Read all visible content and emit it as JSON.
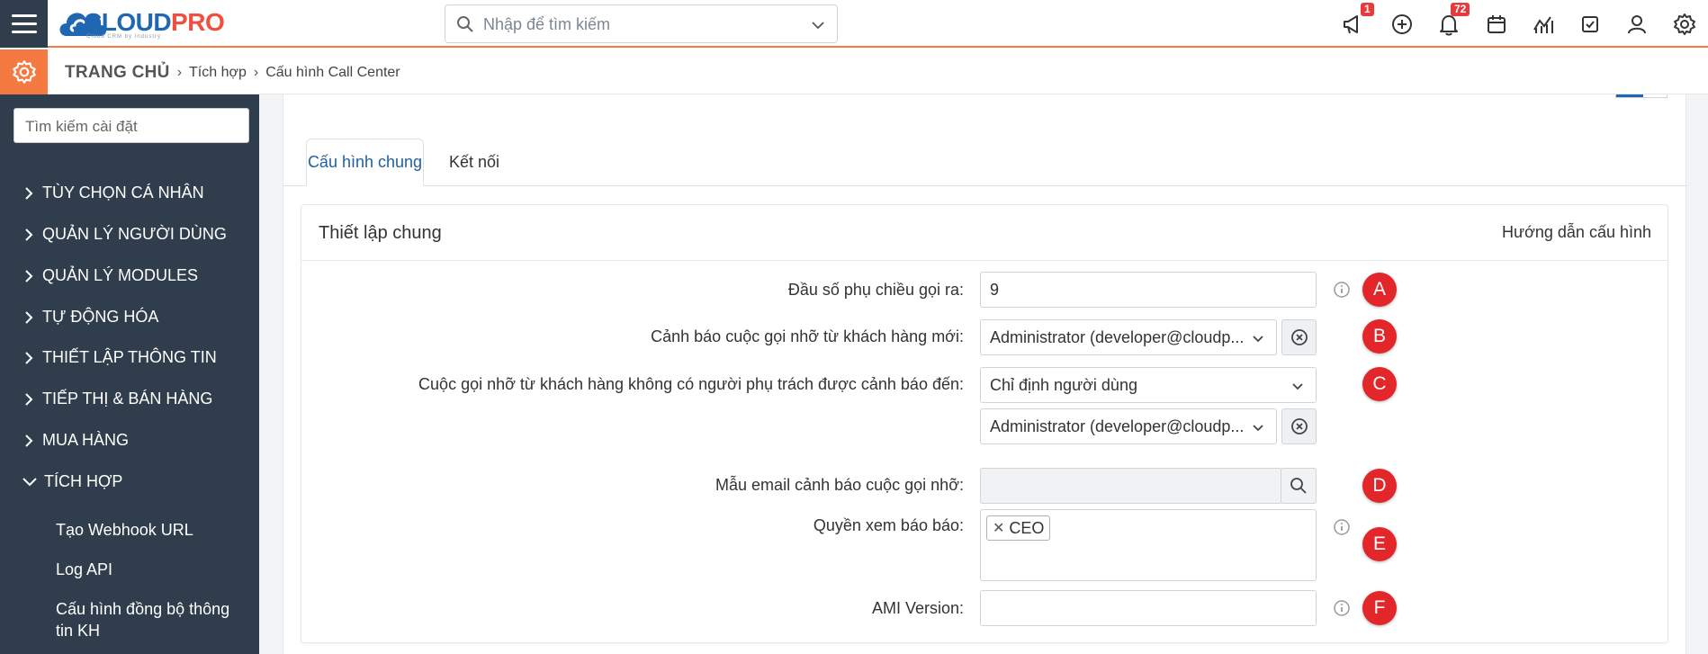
{
  "brand": {
    "name_main": "CLOUD",
    "name_accent": "PRO",
    "tagline": "Cloud CRM by Industry",
    "accent_color": "#f47a42",
    "primary_color": "#1f67b1"
  },
  "header": {
    "search_placeholder": "Nhập để tìm kiếm",
    "announcement_badge": "1",
    "notification_badge": "72"
  },
  "breadcrumb": {
    "home": "TRANG CHỦ",
    "level1": "Tích hợp",
    "level2": "Cấu hình Call Center"
  },
  "sidebar": {
    "search_placeholder": "Tìm kiếm cài đặt",
    "items": [
      {
        "label": "TÙY CHỌN CÁ NHÂN"
      },
      {
        "label": "QUẢN LÝ NGƯỜI DÙNG"
      },
      {
        "label": "QUẢN LÝ MODULES"
      },
      {
        "label": "TỰ ĐỘNG HÓA"
      },
      {
        "label": "THIẾT LẬP THÔNG TIN"
      },
      {
        "label": "TIẾP THỊ & BÁN HÀNG"
      },
      {
        "label": "MUA HÀNG"
      },
      {
        "label": "TÍCH HỢP"
      }
    ],
    "subitems": [
      {
        "label": "Tạo Webhook URL"
      },
      {
        "label": "Log API"
      },
      {
        "label": "Cấu hình đồng bộ thông tin KH"
      }
    ]
  },
  "tabs": [
    {
      "label": "Cấu hình chung"
    },
    {
      "label": "Kết nối"
    }
  ],
  "card": {
    "title": "Thiết lập chung",
    "help_link": "Hướng dẫn cấu hình"
  },
  "form": {
    "prefix": {
      "label": "Đầu số phụ chiều gọi ra:",
      "value": "9",
      "marker": "A"
    },
    "missed_new": {
      "label": "Cảnh báo cuộc gọi nhỡ từ khách hàng mới:",
      "value": "Administrator (developer@cloudp...",
      "marker": "B"
    },
    "missed_unassigned": {
      "label": "Cuộc gọi nhỡ từ khách hàng không có người phụ trách được cảnh báo đến:",
      "mode_value": "Chỉ định người dùng",
      "user_value": "Administrator (developer@cloudp...",
      "marker": "C"
    },
    "email_template": {
      "label": "Mẫu email cảnh báo cuộc gọi nhỡ:",
      "value": "",
      "marker": "D"
    },
    "report_perm": {
      "label": "Quyền xem báo báo:",
      "tag": "CEO",
      "marker": "E"
    },
    "ami_version": {
      "label": "AMI Version:",
      "value": "",
      "marker": "F"
    }
  }
}
